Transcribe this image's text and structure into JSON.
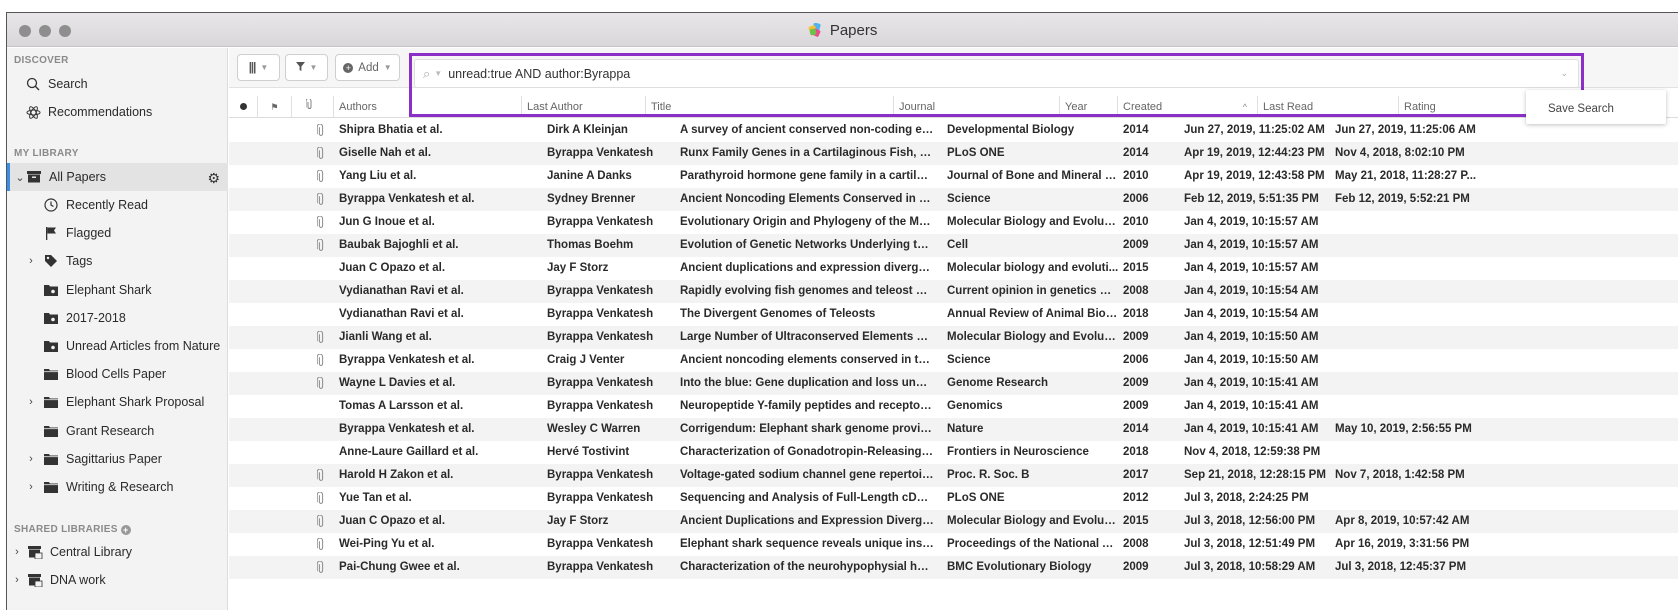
{
  "window": {
    "title": "Papers"
  },
  "sidebar": {
    "discover_header": "DISCOVER",
    "discover": [
      {
        "label": "Search",
        "icon": "search-icon"
      },
      {
        "label": "Recommendations",
        "icon": "atom-icon"
      }
    ],
    "library_header": "MY LIBRARY",
    "all_papers": {
      "label": "All Papers",
      "icon": "archive-icon",
      "expanded": true
    },
    "library_items": [
      {
        "label": "Recently Read",
        "icon": "clock-icon",
        "expandable": false
      },
      {
        "label": "Flagged",
        "icon": "flag-icon",
        "expandable": false
      },
      {
        "label": "Tags",
        "icon": "tag-icon",
        "expandable": true
      },
      {
        "label": "Elephant Shark",
        "icon": "smart-folder-icon",
        "expandable": false
      },
      {
        "label": "2017-2018",
        "icon": "smart-folder-icon",
        "expandable": false
      },
      {
        "label": "Unread Articles from Nature",
        "icon": "smart-folder-icon",
        "expandable": false
      },
      {
        "label": "Blood Cells Paper",
        "icon": "folder-icon",
        "expandable": false
      },
      {
        "label": "Elephant Shark Proposal",
        "icon": "folder-icon",
        "expandable": true
      },
      {
        "label": "Grant Research",
        "icon": "folder-icon",
        "expandable": false
      },
      {
        "label": "Sagittarius Paper",
        "icon": "folder-icon",
        "expandable": true
      },
      {
        "label": "Writing & Research",
        "icon": "folder-icon",
        "expandable": true
      }
    ],
    "shared_header": "SHARED LIBRARIES",
    "shared": [
      {
        "label": "Central Library",
        "icon": "shared-library-icon"
      },
      {
        "label": "DNA work",
        "icon": "shared-library-icon"
      }
    ]
  },
  "toolbar": {
    "columns_icon": "columns-icon",
    "filter_icon": "filter-icon",
    "add_label": "Add"
  },
  "search": {
    "query": "unread:true AND author:Byrappa",
    "save_search_label": "Save Search"
  },
  "table": {
    "columns": {
      "unread": "unread-dot-icon",
      "flag": "flag-icon",
      "attachment": "paperclip-icon",
      "authors": "Authors",
      "last_author": "Last Author",
      "title": "Title",
      "journal": "Journal",
      "year": "Year",
      "created": "Created",
      "last_read": "Last Read",
      "rating": "Rating"
    },
    "sort": {
      "column": "Created",
      "direction": "ascending-indicator"
    },
    "rows": [
      {
        "attachment": true,
        "authors": "Shipra Bhatia et al.",
        "last_author": "Dirk A Kleinjan",
        "title": "A survey of ancient conserved non-coding ele...",
        "journal": "Developmental Biology",
        "year": "2014",
        "created": "Jun 27, 2019, 11:25:02 AM",
        "last_read": "Jun 27, 2019, 11:25:06 AM"
      },
      {
        "attachment": true,
        "authors": "Giselle Nah et al.",
        "last_author": "Byrappa Venkatesh",
        "title": "Runx Family Genes in a Cartilaginous Fish, the ...",
        "journal": "PLoS ONE",
        "year": "2014",
        "created": "Apr 19, 2019, 12:44:23 PM",
        "last_read": "Nov 4, 2018, 8:02:10 PM"
      },
      {
        "attachment": true,
        "authors": "Yang Liu et al.",
        "last_author": "Janine A Danks",
        "title": "Parathyroid hormone gene family in a cartilagi...",
        "journal": "Journal of Bone and Mineral R...",
        "year": "2010",
        "created": "Apr 19, 2019, 12:43:58 PM",
        "last_read": "May 21, 2018, 11:28:27 P..."
      },
      {
        "attachment": true,
        "authors": "Byrappa Venkatesh et al.",
        "last_author": "Sydney Brenner",
        "title": "Ancient Noncoding Elements Conserved in the...",
        "journal": "Science",
        "year": "2006",
        "created": "Feb 12, 2019, 5:51:35 PM",
        "last_read": "Feb 12, 2019, 5:52:21 PM"
      },
      {
        "attachment": true,
        "authors": "Jun G Inoue et al.",
        "last_author": "Byrappa Venkatesh",
        "title": "Evolutionary Origin and Phylogeny of the Mod...",
        "journal": "Molecular Biology and Evoluti...",
        "year": "2010",
        "created": "Jan 4, 2019, 10:15:57 AM",
        "last_read": ""
      },
      {
        "attachment": true,
        "authors": "Baubak Bajoghli et al.",
        "last_author": "Thomas Boehm",
        "title": "Evolution of Genetic Networks Underlying the ...",
        "journal": "Cell",
        "year": "2009",
        "created": "Jan 4, 2019, 10:15:57 AM",
        "last_read": ""
      },
      {
        "attachment": false,
        "authors": "Juan C Opazo et al.",
        "last_author": "Jay F Storz",
        "title": "Ancient duplications and expression divergen...",
        "journal": "Molecular biology and evoluti...",
        "year": "2015",
        "created": "Jan 4, 2019, 10:15:57 AM",
        "last_read": ""
      },
      {
        "attachment": false,
        "authors": "Vydianathan Ravi et al.",
        "last_author": "Byrappa Venkatesh",
        "title": "Rapidly evolving fish genomes and teleost div...",
        "journal": "Current opinion in genetics & ...",
        "year": "2008",
        "created": "Jan 4, 2019, 10:15:54 AM",
        "last_read": ""
      },
      {
        "attachment": false,
        "authors": "Vydianathan Ravi et al.",
        "last_author": "Byrappa Venkatesh",
        "title": "The Divergent Genomes of Teleosts",
        "journal": "Annual Review of Animal Bios...",
        "year": "2018",
        "created": "Jan 4, 2019, 10:15:54 AM",
        "last_read": ""
      },
      {
        "attachment": true,
        "authors": "Jianli Wang et al.",
        "last_author": "Byrappa Venkatesh",
        "title": "Large Number of Ultraconserved Elements We...",
        "journal": "Molecular Biology and Evoluti...",
        "year": "2009",
        "created": "Jan 4, 2019, 10:15:50 AM",
        "last_read": ""
      },
      {
        "attachment": true,
        "authors": "Byrappa Venkatesh et al.",
        "last_author": "Craig J Venter",
        "title": "Ancient noncoding elements conserved in the ...",
        "journal": "Science",
        "year": "2006",
        "created": "Jan 4, 2019, 10:15:50 AM",
        "last_read": ""
      },
      {
        "attachment": true,
        "authors": "Wayne L Davies et al.",
        "last_author": "Byrappa Venkatesh",
        "title": "Into the blue: Gene duplication and loss underl...",
        "journal": "Genome Research",
        "year": "2009",
        "created": "Jan 4, 2019, 10:15:41 AM",
        "last_read": ""
      },
      {
        "attachment": false,
        "authors": "Tomas A Larsson et al.",
        "last_author": "Byrappa Venkatesh",
        "title": "Neuropeptide Y-family peptides and receptors...",
        "journal": "Genomics",
        "year": "2009",
        "created": "Jan 4, 2019, 10:15:41 AM",
        "last_read": ""
      },
      {
        "attachment": false,
        "authors": "Byrappa Venkatesh et al.",
        "last_author": "Wesley C Warren",
        "title": "Corrigendum: Elephant shark genome provide...",
        "journal": "Nature",
        "year": "2014",
        "created": "Jan 4, 2019, 10:15:41 AM",
        "last_read": "May 10, 2019, 2:56:55 PM"
      },
      {
        "attachment": false,
        "authors": "Anne-Laure Gaillard et al.",
        "last_author": "Hervé Tostivint",
        "title": "Characterization of Gonadotropin-Releasing H...",
        "journal": "Frontiers in Neuroscience",
        "year": "2018",
        "created": "Nov 4, 2018, 12:59:38 PM",
        "last_read": ""
      },
      {
        "attachment": true,
        "authors": "Harold H Zakon et al.",
        "last_author": "Byrappa Venkatesh",
        "title": "Voltage-gated sodium channel gene repertoir...",
        "journal": "Proc. R. Soc. B",
        "year": "2017",
        "created": "Sep 21, 2018, 12:28:15 PM",
        "last_read": "Nov 7, 2018, 1:42:58 PM"
      },
      {
        "attachment": true,
        "authors": "Yue Tan et al.",
        "last_author": "Byrappa Venkatesh",
        "title": "Sequencing and Analysis of Full-Length cDNA...",
        "journal": "PLoS ONE",
        "year": "2012",
        "created": "Jul 3, 2018, 2:24:25 PM",
        "last_read": ""
      },
      {
        "attachment": true,
        "authors": "Juan C Opazo et al.",
        "last_author": "Jay F Storz",
        "title": "Ancient Duplications and Expression Divergen...",
        "journal": "Molecular Biology and Evoluti...",
        "year": "2015",
        "created": "Jul 3, 2018, 12:56:00 PM",
        "last_read": "Apr 8, 2019, 10:57:42 AM"
      },
      {
        "attachment": true,
        "authors": "Wei-Ping Yu et al.",
        "last_author": "Byrappa Venkatesh",
        "title": "Elephant shark sequence reveals unique insig...",
        "journal": "Proceedings of the National A...",
        "year": "2008",
        "created": "Jul 3, 2018, 12:51:49 PM",
        "last_read": "Apr 16, 2019, 3:31:56 PM"
      },
      {
        "attachment": true,
        "authors": "Pai-Chung Gwee et al.",
        "last_author": "Byrappa Venkatesh",
        "title": "Characterization of the neurohypophysial hor...",
        "journal": "BMC Evolutionary Biology",
        "year": "2009",
        "created": "Jul 3, 2018, 10:58:29 AM",
        "last_read": "Jul 3, 2018, 12:45:37 PM"
      }
    ]
  },
  "colors": {
    "highlight_border": "#8c2fc7",
    "selection_accent": "#3a8ee6"
  }
}
